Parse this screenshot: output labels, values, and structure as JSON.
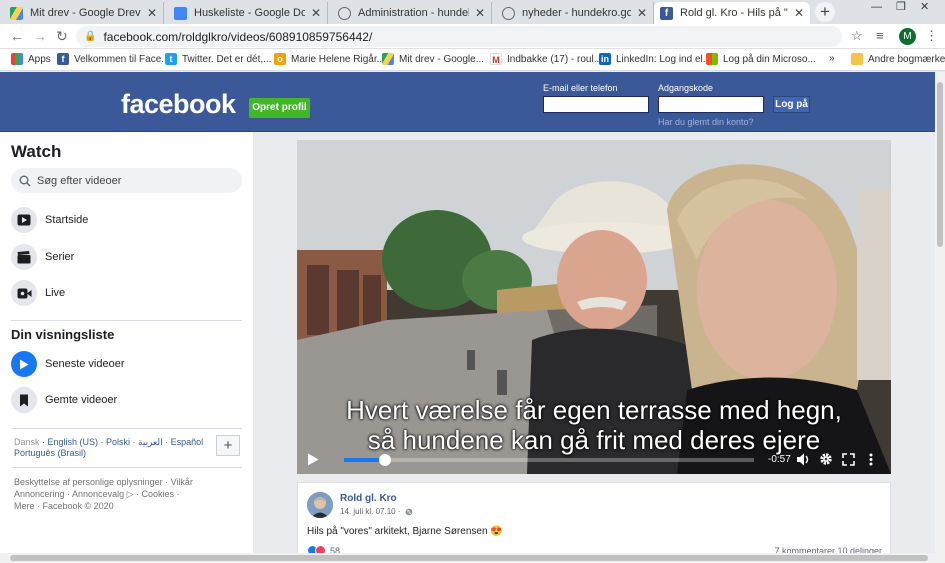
{
  "tabs": [
    {
      "title": "Mit drev - Google Drev",
      "favicon": "google-drive-icon",
      "color": "#1fa463",
      "active": false
    },
    {
      "title": "Huskeliste - Google Docs",
      "favicon": "google-docs-icon",
      "color": "#4285f4",
      "active": false
    },
    {
      "title": "Administration - hundekro.go2",
      "favicon": "globe-icon",
      "color": "#666666",
      "active": false
    },
    {
      "title": "nyheder - hundekro.go2net.dk",
      "favicon": "globe-icon",
      "color": "#666666",
      "active": false
    },
    {
      "title": "Rold gl. Kro - Hils på \"vores\" a",
      "favicon": "facebook-icon",
      "color": "#3b5998",
      "active": true
    }
  ],
  "addressbar": {
    "url": "facebook.com/roldglkro/videos/608910859756442/",
    "profile_initial": "M"
  },
  "bookmarks": [
    {
      "label": "Apps",
      "icon": "apps-grid-icon"
    },
    {
      "label": "Velkommen til Face...",
      "icon": "facebook-icon"
    },
    {
      "label": "Twitter. Det er dét,...",
      "icon": "twitter-icon"
    },
    {
      "label": "Marie Helene Rigår...",
      "icon": "bookmark-page-icon"
    },
    {
      "label": "Mit drev - Google...",
      "icon": "google-drive-icon"
    },
    {
      "label": "Indbakke (17) - roul...",
      "icon": "gmail-icon"
    },
    {
      "label": "LinkedIn: Log ind el...",
      "icon": "linkedin-icon"
    },
    {
      "label": "Log på din Microso...",
      "icon": "microsoft-icon"
    }
  ],
  "bookmarks_overflow": "»",
  "other_bookmarks": "Andre bogmærker",
  "header": {
    "logo": "facebook",
    "signup": "Opret profil",
    "email_label": "E-mail eller telefon",
    "password_label": "Adgangskode",
    "login": "Log på",
    "forgot": "Har du glemt din konto?",
    "brand_color": "#3b5998"
  },
  "sidebar": {
    "title": "Watch",
    "search_placeholder": "Søg efter videoer",
    "items": [
      {
        "label": "Startside",
        "icon": "video-play-icon"
      },
      {
        "label": "Serier",
        "icon": "clapperboard-icon"
      },
      {
        "label": "Live",
        "icon": "live-camera-icon"
      }
    ],
    "list_title": "Din visningsliste",
    "list_items": [
      {
        "label": "Seneste videoer",
        "icon": "play-circle-icon"
      },
      {
        "label": "Gemte videoer",
        "icon": "bookmark-icon"
      }
    ],
    "languages": [
      "Dansk",
      "English (US)",
      "Polski",
      "العربية",
      "Español",
      "Português (Brasil)"
    ],
    "footer_lines": [
      "Beskyttelse af personlige oplysninger · Vilkår",
      "Annoncering · Annoncevalg ▷ · Cookies ·",
      "Mere · Facebook © 2020"
    ]
  },
  "video": {
    "subtitle_line1": "Hvert værelse får egen terrasse med hegn,",
    "subtitle_line2": "så hundene kan gå frit med deres ejere",
    "time_remaining": "-0:57",
    "progress": 0.1
  },
  "post": {
    "page_name": "Rold gl. Kro",
    "meta": "14. juli kl. 07.10 ·",
    "text": "Hils på \"vores\" arkitekt, Bjarne Sørensen 😍",
    "reaction_count": "58",
    "stats": "7 kommentarer 10 delinger"
  }
}
